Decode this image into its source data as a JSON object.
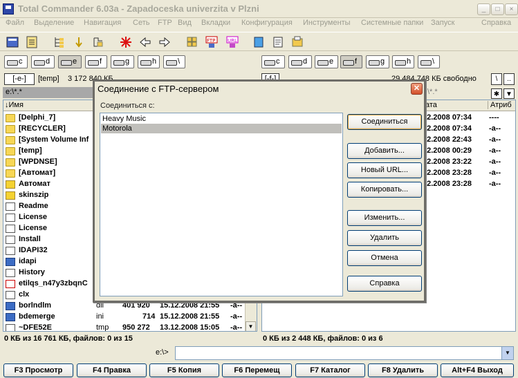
{
  "window": {
    "title": "Total Commander 6.03a - Zapadoceska univerzita v Plzni",
    "min_label": "_",
    "max_label": "□",
    "close_label": "×"
  },
  "menu": {
    "items": [
      "Файл",
      "Выделение",
      "Навигация",
      "Сеть",
      "FTP",
      "Вид",
      "Вкладки",
      "Конфигурация",
      "Инструменты",
      "Системные папки",
      "Запуск"
    ],
    "help": "Справка"
  },
  "toolbar": {
    "icons": [
      "refresh-icon",
      "brief-view-icon",
      "tree-view-icon",
      "sort-icon",
      "filter-icon",
      "select-icon",
      "back-icon",
      "forward-icon",
      "pack-icon",
      "ftp-connect-icon",
      "ftp-new-icon",
      "copy-names-icon",
      "notepad-icon",
      "explorer-icon"
    ]
  },
  "left_drives": [
    "c",
    "d",
    "e",
    "f",
    "g",
    "h",
    "\\"
  ],
  "right_drives": [
    "c",
    "d",
    "e",
    "f",
    "g",
    "h",
    "\\"
  ],
  "left_path": {
    "drive": "[-e-]",
    "label": "[temp]",
    "free": "3 172 840 КБ ...",
    "current": "e:\\*.*"
  },
  "right_path": {
    "drive": "[-f-]",
    "free": "29 484 748 КБ свободно",
    "filter": "\\*.*"
  },
  "left_panel": {
    "col_name": "↓Имя",
    "files": [
      {
        "name": "[Delphi_7]",
        "icon": "folder"
      },
      {
        "name": "[RECYCLER]",
        "icon": "folder"
      },
      {
        "name": "[System Volume Inf",
        "icon": "folder"
      },
      {
        "name": "[temp]",
        "icon": "folder"
      },
      {
        "name": "[WPDNSE]",
        "icon": "folder"
      },
      {
        "name": "[Автомат]",
        "icon": "folder"
      },
      {
        "name": "Автомат",
        "icon": "arch"
      },
      {
        "name": "skinszip",
        "icon": "arch"
      },
      {
        "name": "Readme",
        "icon": "doc"
      },
      {
        "name": "License",
        "icon": "doc"
      },
      {
        "name": "License",
        "icon": "doc"
      },
      {
        "name": "Install",
        "icon": "doc"
      },
      {
        "name": "IDAPI32",
        "icon": "doc"
      },
      {
        "name": "idapi",
        "icon": "exe"
      },
      {
        "name": "History",
        "icon": "doc"
      },
      {
        "name": "etilqs_n47y3zbqnC",
        "icon": "red"
      },
      {
        "name": "clx",
        "icon": "doc"
      },
      {
        "name": "borlndlm",
        "icon": "exe",
        "ext": "dll",
        "size": "401 920",
        "date": "15.12.2008 21:55",
        "attr": "-a--"
      },
      {
        "name": "bdemerge",
        "icon": "exe",
        "ext": "ini",
        "size": "714",
        "date": "15.12.2008 21:55",
        "attr": "-a--"
      },
      {
        "name": "~DFE52E",
        "icon": "doc",
        "ext": "tmp",
        "size": "950 272",
        "date": "13.12.2008 15:05",
        "attr": "-a--"
      }
    ],
    "status": "0 КБ из 16 761 КБ, файлов: 0 из 15"
  },
  "right_panel": {
    "col_date": "ата",
    "col_attr": "Атриб",
    "rows": [
      {
        "date": "12.2008 07:34",
        "attr": "----"
      },
      {
        "date": "12.2008 07:34",
        "attr": "-a--"
      },
      {
        "date": "12.2008 22:43",
        "attr": "-a--"
      },
      {
        "date": "12.2008 00:29",
        "attr": "-a--"
      },
      {
        "date": "12.2008 23:22",
        "attr": "-a--"
      },
      {
        "date": "12.2008 23:28",
        "attr": "-a--"
      },
      {
        "date": "12.2008 23:28",
        "attr": "-a--"
      }
    ],
    "status": "0 КБ из 2 448 КБ, файлов: 0 из 6"
  },
  "cmdline": {
    "label": "e:\\>",
    "value": ""
  },
  "fkeys": [
    "F3 Просмотр",
    "F4 Правка",
    "F5 Копия",
    "F6 Перемещ",
    "F7 Каталог",
    "F8 Удалить",
    "Alt+F4 Выход"
  ],
  "dialog": {
    "title": "Соединение с FTP-сервером",
    "label": "Соединиться с:",
    "connections": [
      "Heavy Music",
      "Motorola"
    ],
    "selected_index": 1,
    "buttons": {
      "connect": "Соединиться",
      "add": "Добавить...",
      "new_url": "Новый URL...",
      "copy": "Копировать...",
      "edit": "Изменить...",
      "delete": "Удалить",
      "cancel": "Отмена",
      "help": "Справка"
    }
  }
}
